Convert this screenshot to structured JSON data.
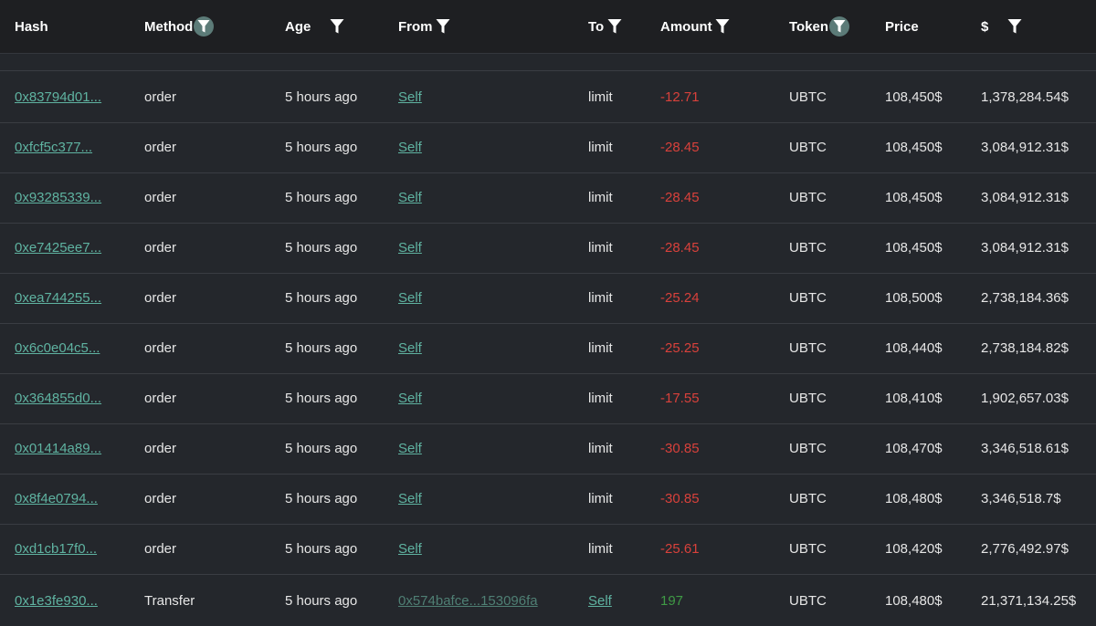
{
  "columns": {
    "hash": "Hash",
    "method": "Method",
    "age": "Age",
    "from": "From",
    "to": "To",
    "amount": "Amount",
    "token": "Token",
    "price": "Price",
    "usd": "$"
  },
  "colors": {
    "link": "#5fb3a1",
    "negative": "#d9413b",
    "positive": "#3f9a45",
    "header_bg": "#1e1f22",
    "row_bg": "#24272c"
  },
  "rows": [
    {
      "hash": "0x83794d01...",
      "method": "order",
      "age": "5 hours ago",
      "from": "Self",
      "to": "limit",
      "amount": "-12.71",
      "token": "UBTC",
      "price": "108,450$",
      "usd": "1,378,284.54$"
    },
    {
      "hash": "0xfcf5c377...",
      "method": "order",
      "age": "5 hours ago",
      "from": "Self",
      "to": "limit",
      "amount": "-28.45",
      "token": "UBTC",
      "price": "108,450$",
      "usd": "3,084,912.31$"
    },
    {
      "hash": "0x93285339...",
      "method": "order",
      "age": "5 hours ago",
      "from": "Self",
      "to": "limit",
      "amount": "-28.45",
      "token": "UBTC",
      "price": "108,450$",
      "usd": "3,084,912.31$"
    },
    {
      "hash": "0xe7425ee7...",
      "method": "order",
      "age": "5 hours ago",
      "from": "Self",
      "to": "limit",
      "amount": "-28.45",
      "token": "UBTC",
      "price": "108,450$",
      "usd": "3,084,912.31$"
    },
    {
      "hash": "0xea744255...",
      "method": "order",
      "age": "5 hours ago",
      "from": "Self",
      "to": "limit",
      "amount": "-25.24",
      "token": "UBTC",
      "price": "108,500$",
      "usd": "2,738,184.36$"
    },
    {
      "hash": "0x6c0e04c5...",
      "method": "order",
      "age": "5 hours ago",
      "from": "Self",
      "to": "limit",
      "amount": "-25.25",
      "token": "UBTC",
      "price": "108,440$",
      "usd": "2,738,184.82$"
    },
    {
      "hash": "0x364855d0...",
      "method": "order",
      "age": "5 hours ago",
      "from": "Self",
      "to": "limit",
      "amount": "-17.55",
      "token": "UBTC",
      "price": "108,410$",
      "usd": "1,902,657.03$"
    },
    {
      "hash": "0x01414a89...",
      "method": "order",
      "age": "5 hours ago",
      "from": "Self",
      "to": "limit",
      "amount": "-30.85",
      "token": "UBTC",
      "price": "108,470$",
      "usd": "3,346,518.61$"
    },
    {
      "hash": "0x8f4e0794...",
      "method": "order",
      "age": "5 hours ago",
      "from": "Self",
      "to": "limit",
      "amount": "-30.85",
      "token": "UBTC",
      "price": "108,480$",
      "usd": "3,346,518.7$"
    },
    {
      "hash": "0xd1cb17f0...",
      "method": "order",
      "age": "5 hours ago",
      "from": "Self",
      "to": "limit",
      "amount": "-25.61",
      "token": "UBTC",
      "price": "108,420$",
      "usd": "2,776,492.97$"
    },
    {
      "hash": "0x1e3fe930...",
      "method": "Transfer",
      "age": "5 hours ago",
      "from": "0x574bafce...153096fa",
      "to": "Self",
      "amount": "197",
      "token": "UBTC",
      "price": "108,480$",
      "usd": "21,371,134.25$"
    }
  ]
}
